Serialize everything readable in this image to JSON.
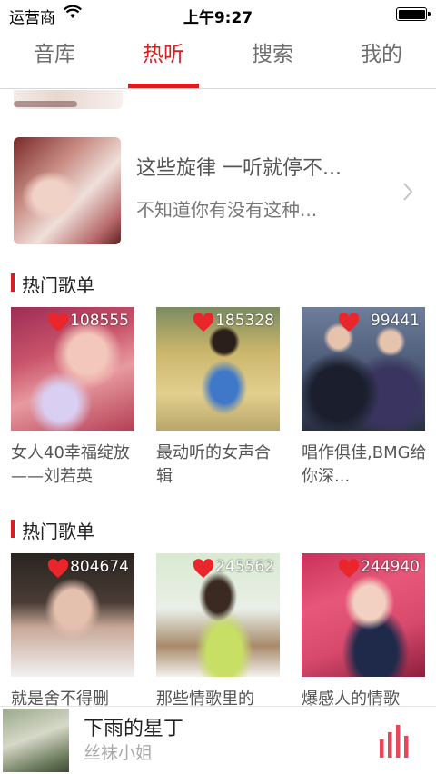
{
  "status_bar": {
    "carrier": "运营商",
    "time": "上午9:27"
  },
  "tabs": [
    {
      "label": "音库",
      "active": false
    },
    {
      "label": "热听",
      "active": true
    },
    {
      "label": "搜索",
      "active": false
    },
    {
      "label": "我的",
      "active": false
    }
  ],
  "promo": {
    "title": "这些旋律 一听就停不...",
    "subtitle": "不知道你有没有这种..."
  },
  "sections": [
    {
      "heading": "热门歌单",
      "playlists": [
        {
          "count": "108555",
          "title": "女人40幸福绽放——刘若英"
        },
        {
          "count": "185328",
          "title": "最动听的女声合辑"
        },
        {
          "count": "99441",
          "title": "唱作俱佳,BMG给你深..."
        }
      ]
    },
    {
      "heading": "热门歌单",
      "playlists": [
        {
          "count": "804674",
          "title": "就是舍不得删"
        },
        {
          "count": "245562",
          "title": "那些情歌里的"
        },
        {
          "count": "244940",
          "title": "爆感人的情歌"
        }
      ]
    }
  ],
  "player": {
    "title": "下雨的星丁",
    "artist": "丝袜小姐"
  },
  "colors": {
    "accent": "#d81e1e",
    "heart": "#e8262b"
  },
  "icons": {
    "wifi": "wifi-icon",
    "battery": "battery-icon",
    "heart": "heart-icon",
    "chevron": "chevron-right-icon",
    "equalizer": "equalizer-icon"
  }
}
